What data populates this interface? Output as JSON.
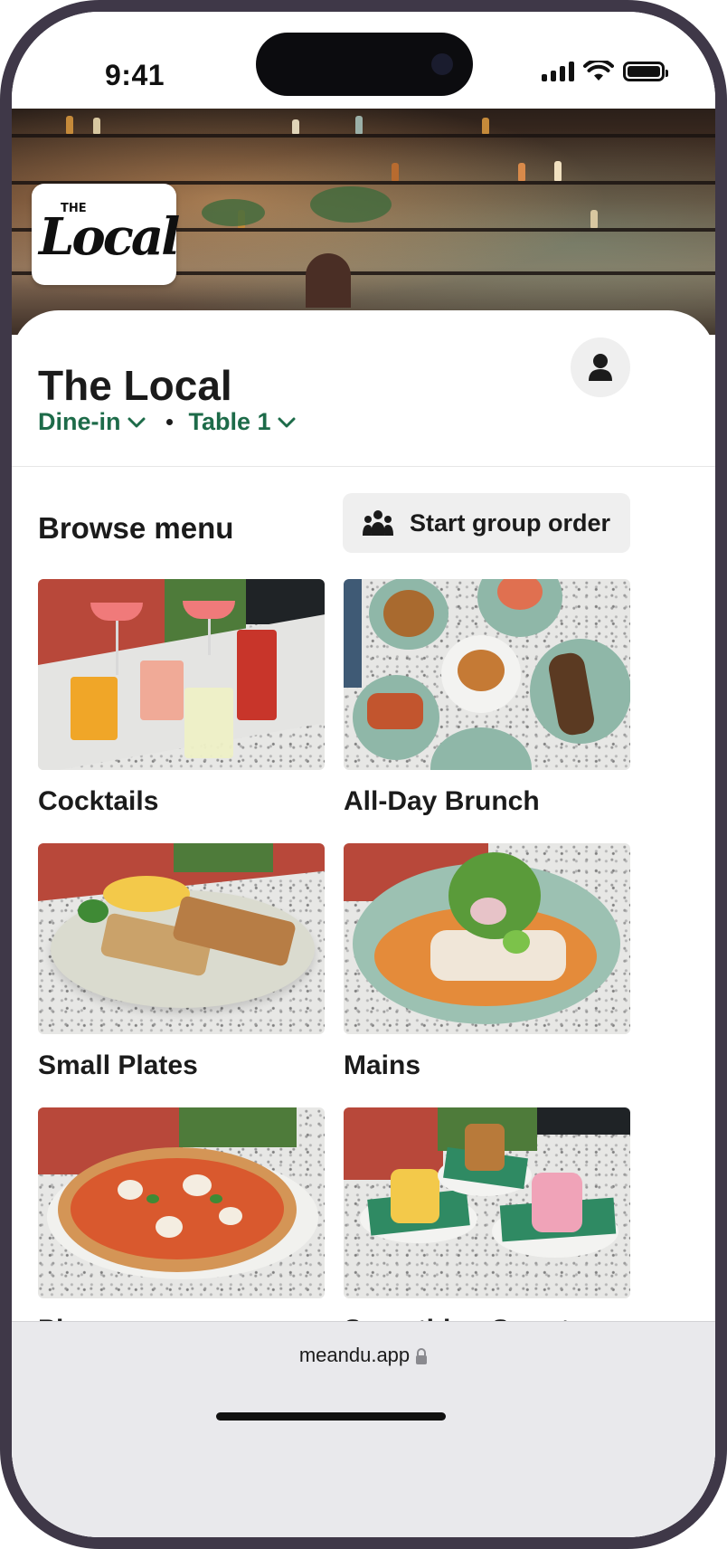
{
  "status": {
    "time": "9:41"
  },
  "venue": {
    "name": "The Local",
    "logo_small": "THE",
    "logo_big": "Local",
    "mode": "Dine-in",
    "table": "Table 1"
  },
  "menu": {
    "title": "Browse menu",
    "group_order_label": "Start group order",
    "categories": [
      {
        "label": "Cocktails"
      },
      {
        "label": "All-Day Brunch"
      },
      {
        "label": "Small Plates"
      },
      {
        "label": "Mains"
      },
      {
        "label": "Pizzas"
      },
      {
        "label": "Something Sweet"
      }
    ]
  },
  "browser": {
    "url": "meandu.app"
  },
  "colors": {
    "accent": "#1d6b49",
    "frame": "#3f3848",
    "button_bg": "#efefef"
  },
  "icons": {
    "profile": "user-icon",
    "group": "group-icon",
    "chevron": "chevron-down-icon",
    "lock": "lock-icon"
  }
}
